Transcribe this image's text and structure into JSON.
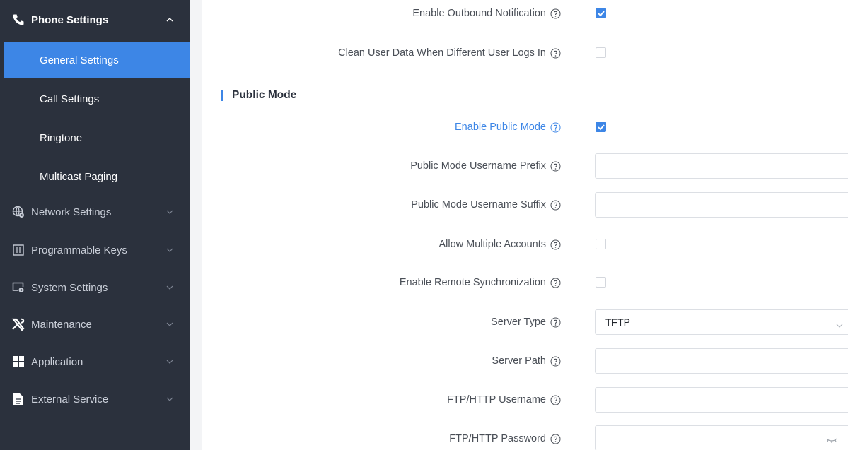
{
  "sidebar": {
    "phone_settings": "Phone Settings",
    "sub_items": [
      "General Settings",
      "Call Settings",
      "Ringtone",
      "Multicast Paging"
    ],
    "active_index": 0,
    "items": [
      {
        "label": "Network Settings",
        "icon": "globe-gear-icon"
      },
      {
        "label": "Programmable Keys",
        "icon": "keypad-icon"
      },
      {
        "label": "System Settings",
        "icon": "monitor-gear-icon"
      },
      {
        "label": "Maintenance",
        "icon": "tools-icon"
      },
      {
        "label": "Application",
        "icon": "grid-icon"
      },
      {
        "label": "External Service",
        "icon": "document-icon"
      }
    ]
  },
  "form": {
    "enable_outbound_notification": {
      "label": "Enable Outbound Notification",
      "checked": true
    },
    "clean_user_data": {
      "label": "Clean User Data When Different User Logs In",
      "checked": false
    },
    "section_title": "Public Mode",
    "enable_public_mode": {
      "label": "Enable Public Mode",
      "checked": true
    },
    "username_prefix": {
      "label": "Public Mode Username Prefix",
      "value": ""
    },
    "username_suffix": {
      "label": "Public Mode Username Suffix",
      "value": ""
    },
    "allow_multiple_accounts": {
      "label": "Allow Multiple Accounts",
      "checked": false
    },
    "enable_remote_sync": {
      "label": "Enable Remote Synchronization",
      "checked": false
    },
    "server_type": {
      "label": "Server Type",
      "value": "TFTP"
    },
    "server_path": {
      "label": "Server Path",
      "value": ""
    },
    "ftp_username": {
      "label": "FTP/HTTP Username",
      "value": ""
    },
    "ftp_password": {
      "label": "FTP/HTTP Password",
      "value": ""
    }
  },
  "colors": {
    "sidebar_bg": "#2b313d",
    "accent": "#3d86e6",
    "label_text": "#4a4f57"
  }
}
